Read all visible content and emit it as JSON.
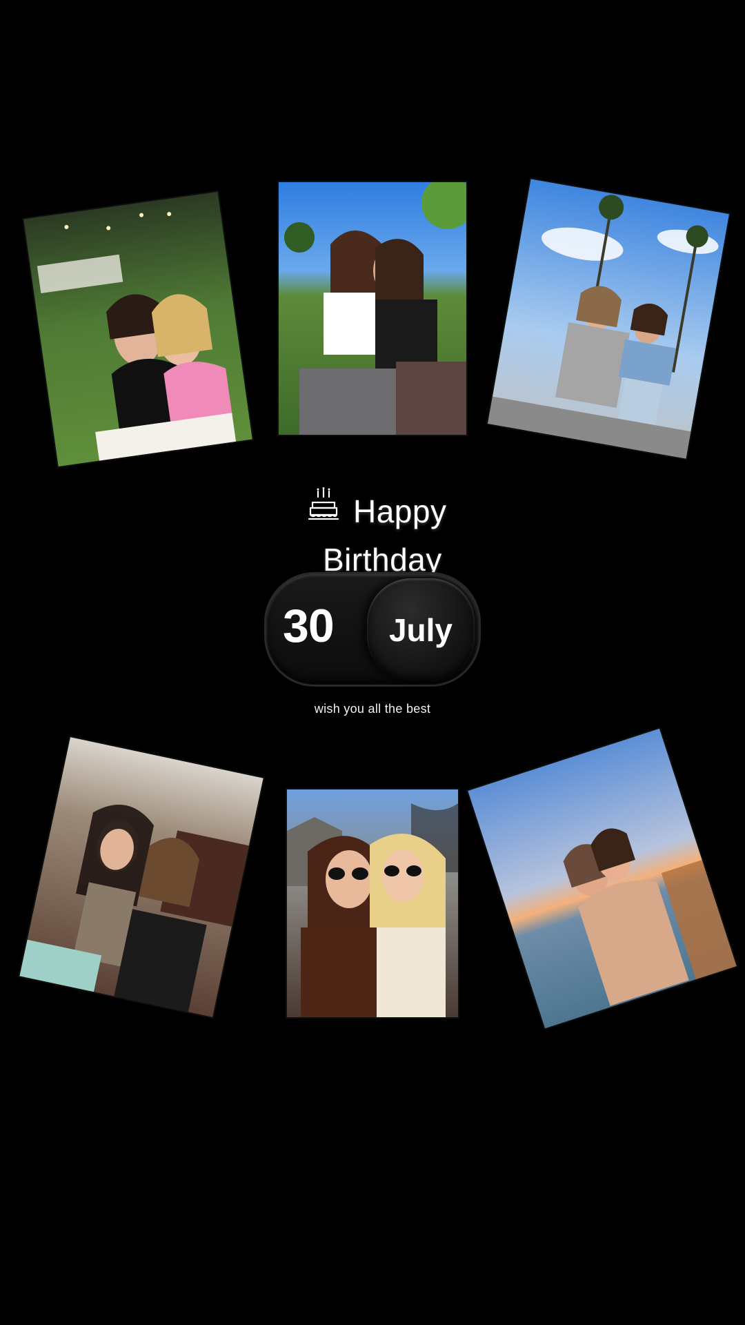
{
  "greeting": {
    "icon": "birthday-cake-icon",
    "line1": "Happy",
    "line2": "Birthday"
  },
  "date": {
    "day": "30",
    "month": "July"
  },
  "subtitle": "wish you all the best",
  "colors": {
    "background": "#000000",
    "text": "#ffffff",
    "pill": "#111111"
  }
}
